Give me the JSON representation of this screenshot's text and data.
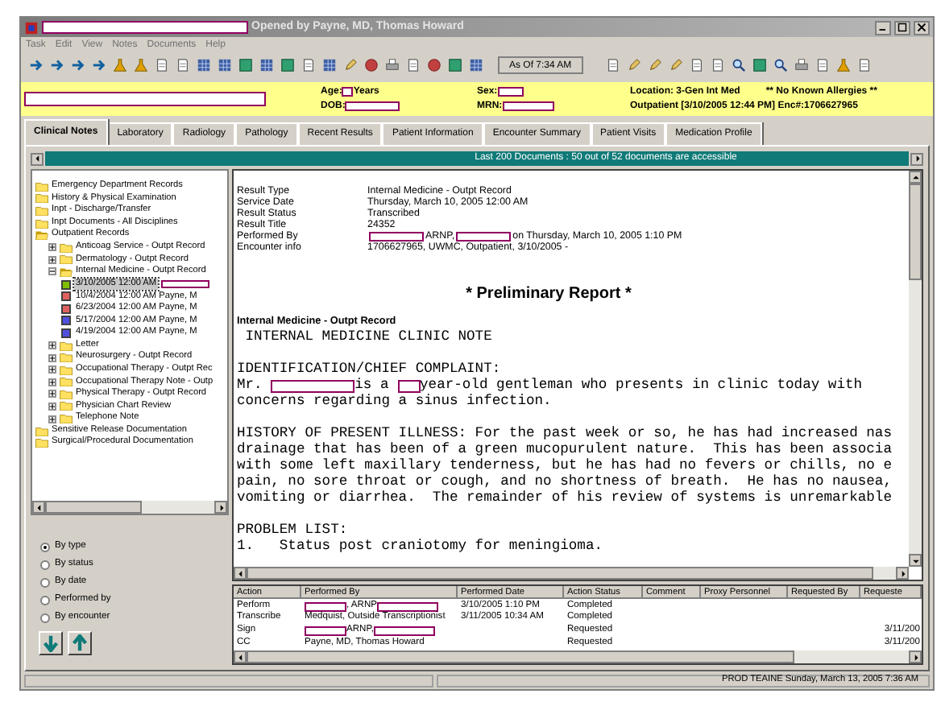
{
  "window": {
    "title": "Opened by Payne, MD, Thomas Howard"
  },
  "menu": [
    {
      "label": "Task"
    },
    {
      "label": "Edit"
    },
    {
      "label": "View"
    },
    {
      "label": "Notes"
    },
    {
      "label": "Documents"
    },
    {
      "label": "Help"
    }
  ],
  "toolbar": {
    "as_of_button": "As Of 7:34 AM"
  },
  "patient_banner": {
    "age_label": "Age:",
    "age_unit": "Years",
    "dob_label": "DOB:",
    "sex_label": "Sex:",
    "mrn_label": "MRN:",
    "location": "Location: 3-Gen Int Med",
    "allergies": "** No Known Allergies **",
    "encounter": "Outpatient [3/10/2005 12:44 PM] Enc#:1706627965"
  },
  "tabs": [
    {
      "label": "Clinical Notes",
      "selected": true
    },
    {
      "label": "Laboratory",
      "selected": false
    },
    {
      "label": "Radiology",
      "selected": false
    },
    {
      "label": "Pathology",
      "selected": false
    },
    {
      "label": "Recent Results",
      "selected": false
    },
    {
      "label": "Patient Information",
      "selected": false
    },
    {
      "label": "Encounter Summary",
      "selected": false
    },
    {
      "label": "Patient Visits",
      "selected": false
    },
    {
      "label": "Medication Profile",
      "selected": false
    }
  ],
  "document_list_header": "Last 200 Documents : 50 out of 52 documents are accessible",
  "tree": [
    {
      "kind": "folder",
      "label": "Emergency Department Records"
    },
    {
      "kind": "folder",
      "label": "History & Physical Examination"
    },
    {
      "kind": "folder",
      "label": "Inpt - Discharge/Transfer"
    },
    {
      "kind": "folder",
      "label": "Inpt Documents - All Disciplines"
    },
    {
      "kind": "folder",
      "label": "Outpatient Records",
      "children": [
        {
          "kind": "folder",
          "label": "Anticoag Service - Outpt Record",
          "expanded": false
        },
        {
          "kind": "folder",
          "label": "Dermatology - Outpt Record",
          "expanded": false
        },
        {
          "kind": "folder",
          "label": "Internal Medicine - Outpt Record",
          "expanded": true,
          "children": [
            {
              "kind": "document",
              "label": "3/10/2005 12:00 AM",
              "redacted": true,
              "color": "#80c000",
              "selected": true
            },
            {
              "kind": "document",
              "label": "10/4/2004 12:00 AM Payne, M",
              "redacted": false,
              "color": "#e06060",
              "selected": false
            },
            {
              "kind": "document",
              "label": "6/23/2004 12:00 AM Payne, M",
              "redacted": false,
              "color": "#e06060",
              "selected": false
            },
            {
              "kind": "document",
              "label": "5/17/2004 12:00 AM Payne, M",
              "redacted": false,
              "color": "#5050e0",
              "selected": false
            },
            {
              "kind": "document",
              "label": "4/19/2004 12:00 AM Payne, M",
              "redacted": false,
              "color": "#5050e0",
              "selected": false
            }
          ]
        },
        {
          "kind": "folder",
          "label": "Letter",
          "expanded": false
        },
        {
          "kind": "folder",
          "label": "Neurosurgery - Outpt Record",
          "expanded": false
        },
        {
          "kind": "folder",
          "label": "Occupational Therapy - Outpt Rec",
          "expanded": false
        },
        {
          "kind": "folder",
          "label": "Occupational Therapy Note - Outp",
          "expanded": false
        },
        {
          "kind": "folder",
          "label": "Physical Therapy - Outpt Record",
          "expanded": false
        },
        {
          "kind": "folder",
          "label": "Physician Chart Review",
          "expanded": false
        },
        {
          "kind": "folder",
          "label": "Telephone Note",
          "expanded": false
        }
      ]
    },
    {
      "kind": "folder",
      "label": "Sensitive Release Documentation"
    },
    {
      "kind": "folder",
      "label": "Surgical/Procedural Documentation"
    }
  ],
  "sort_options": [
    {
      "label": "By type",
      "selected": true
    },
    {
      "label": "By status",
      "selected": false
    },
    {
      "label": "By date",
      "selected": false
    },
    {
      "label": "Performed by",
      "selected": false
    },
    {
      "label": "By encounter",
      "selected": false
    }
  ],
  "document": {
    "fields": [
      {
        "label": "Result Type",
        "segments": [
          {
            "kind": "text",
            "text": "Internal Medicine - Outpt Record"
          }
        ]
      },
      {
        "label": "Service Date",
        "segments": [
          {
            "kind": "text",
            "text": "Thursday, March 10, 2005 12:00 AM"
          }
        ]
      },
      {
        "label": "Result Status",
        "segments": [
          {
            "kind": "text",
            "text": "Transcribed"
          }
        ]
      },
      {
        "label": "Result Title",
        "segments": [
          {
            "kind": "text",
            "text": "24352"
          }
        ]
      },
      {
        "label": "Performed By",
        "segments": [
          {
            "kind": "redacted_long"
          },
          {
            "kind": "text",
            "text": "ARNP,"
          },
          {
            "kind": "redacted_long"
          },
          {
            "kind": "text",
            "text": "on Thursday, March 10, 2005 1:10 PM"
          }
        ]
      },
      {
        "label": "Encounter info",
        "segments": [
          {
            "kind": "text",
            "text": "1706627965, UWMC, Outpatient, 3/10/2005 -"
          }
        ]
      }
    ],
    "heading": "* Preliminary Report *",
    "lines": [
      {
        "kind": "bold",
        "segments": [
          {
            "kind": "text",
            "text": "Internal Medicine - Outpt Record"
          }
        ]
      },
      {
        "kind": "mono",
        "segments": [
          {
            "kind": "text",
            "text": " INTERNAL MEDICINE CLINIC NOTE"
          }
        ]
      },
      {
        "kind": "blank"
      },
      {
        "kind": "mono",
        "segments": [
          {
            "kind": "text",
            "text": "IDENTIFICATION/CHIEF COMPLAINT:"
          }
        ]
      },
      {
        "kind": "mono",
        "segments": [
          {
            "kind": "text",
            "text": "Mr. "
          },
          {
            "kind": "redacted_long"
          },
          {
            "kind": "text",
            "text": "is a "
          },
          {
            "kind": "redacted_short"
          },
          {
            "kind": "text",
            "text": "year-old gentleman who presents in clinic today with"
          }
        ]
      },
      {
        "kind": "mono",
        "segments": [
          {
            "kind": "text",
            "text": "concerns regarding a sinus infection."
          }
        ]
      },
      {
        "kind": "blank"
      },
      {
        "kind": "mono",
        "segments": [
          {
            "kind": "text",
            "text": "HISTORY OF PRESENT ILLNESS: For the past week or so, he has had increased nas"
          }
        ]
      },
      {
        "kind": "mono",
        "segments": [
          {
            "kind": "text",
            "text": "drainage that has been of a green mucopurulent nature.  This has been associa"
          }
        ]
      },
      {
        "kind": "mono",
        "segments": [
          {
            "kind": "text",
            "text": "with some left maxillary tenderness, but he has had no fevers or chills, no e"
          }
        ]
      },
      {
        "kind": "mono",
        "segments": [
          {
            "kind": "text",
            "text": "pain, no sore throat or cough, and no shortness of breath.  He has no nausea,"
          }
        ]
      },
      {
        "kind": "mono",
        "segments": [
          {
            "kind": "text",
            "text": "vomiting or diarrhea.  The remainder of his review of systems is unremarkable"
          }
        ]
      },
      {
        "kind": "blank"
      },
      {
        "kind": "mono",
        "segments": [
          {
            "kind": "text",
            "text": "PROBLEM LIST:"
          }
        ]
      },
      {
        "kind": "mono",
        "segments": [
          {
            "kind": "text",
            "text": "1.   Status post craniotomy for meningioma."
          }
        ]
      }
    ]
  },
  "actions_table": {
    "columns": [
      "Action",
      "Performed By",
      "Performed Date",
      "Action Status",
      "Comment",
      "Proxy Personnel",
      "Requested By",
      "Requeste"
    ],
    "rows": [
      {
        "cells": [
          [
            {
              "kind": "text",
              "text": "Perform"
            }
          ],
          [
            {
              "kind": "redacted_short"
            },
            {
              "kind": "text",
              "text": ", ARNP"
            },
            {
              "kind": "redacted_long"
            }
          ],
          [
            {
              "kind": "text",
              "text": "3/10/2005 1:10 PM"
            }
          ],
          [
            {
              "kind": "text",
              "text": "Completed"
            }
          ],
          [],
          [],
          [],
          []
        ]
      },
      {
        "cells": [
          [
            {
              "kind": "text",
              "text": "Transcribe"
            }
          ],
          [
            {
              "kind": "text",
              "text": "Medquist, Outside Transcriptionist"
            }
          ],
          [
            {
              "kind": "text",
              "text": "3/11/2005 10:34 AM"
            }
          ],
          [
            {
              "kind": "text",
              "text": "Completed"
            }
          ],
          [],
          [],
          [],
          []
        ]
      },
      {
        "cells": [
          [
            {
              "kind": "text",
              "text": "Sign"
            }
          ],
          [
            {
              "kind": "redacted_short"
            },
            {
              "kind": "text",
              "text": "ARNP,"
            },
            {
              "kind": "redacted_long"
            }
          ],
          [],
          [
            {
              "kind": "text",
              "text": "Requested"
            }
          ],
          [],
          [],
          [],
          [
            {
              "kind": "text",
              "text": "3/11/200"
            }
          ]
        ]
      },
      {
        "cells": [
          [
            {
              "kind": "text",
              "text": "CC"
            }
          ],
          [
            {
              "kind": "text",
              "text": "Payne, MD, Thomas Howard"
            }
          ],
          [],
          [
            {
              "kind": "text",
              "text": "Requested"
            }
          ],
          [],
          [],
          [],
          [
            {
              "kind": "text",
              "text": "3/11/200"
            }
          ]
        ]
      }
    ]
  },
  "status_bar": {
    "text": "PROD TEAINE Sunday, March 13, 2005 7:36 AM"
  }
}
